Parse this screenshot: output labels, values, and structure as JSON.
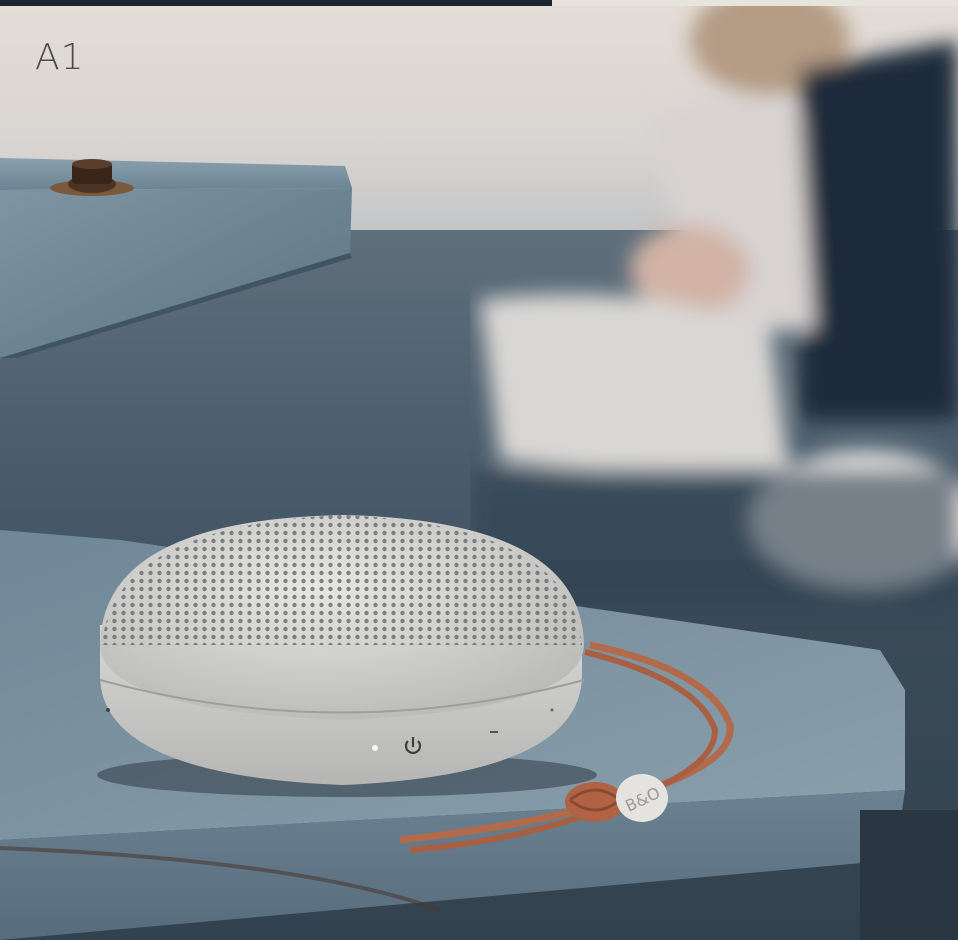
{
  "title": "A1",
  "colors": {
    "top_strip_left": "#1f2433",
    "top_strip_right": "#e7e4de",
    "title_text": "#4a4a4a",
    "speaker_body": "#cfcfcd",
    "strap": "#b36a4a",
    "stone": "#6f8797"
  },
  "icons": {
    "power": "power-icon",
    "volume_down": "minus-icon",
    "volume_up": "plus-icon",
    "status_led": "status-light-icon"
  }
}
